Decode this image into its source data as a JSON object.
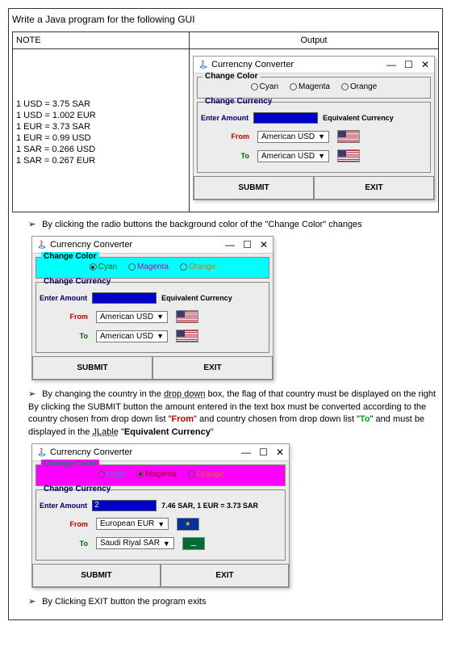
{
  "heading": "Write a Java program for the following GUI",
  "table": {
    "col1": "NOTE",
    "col2": "Output",
    "notes": [
      "1 USD = 3.75 SAR",
      "1 USD = 1.002 EUR",
      "1 EUR = 3.73 SAR",
      "1 EUR = 0.99 USD",
      "1 SAR = 0.266 USD",
      "1 SAR = 0.267 EUR"
    ]
  },
  "win_title": "Currencny Converter",
  "change_color_legend": "Change Color",
  "change_curr_legend": "Change Currency",
  "radios": {
    "cyan": "Cyan",
    "magenta": "Magenta",
    "orange": "Orange"
  },
  "labels": {
    "enter_amount": "Enter Amount",
    "equivalent": "Equivalent Currency",
    "from": "From",
    "to": "To",
    "submit": "SUBMIT",
    "exit": "EXIT"
  },
  "dropdowns": {
    "us": "American USD",
    "eu": "European EUR",
    "sa": "Saudi Riyal SAR"
  },
  "win3": {
    "amount_value": "2",
    "result": "7.46 SAR, 1 EUR = 3.73 SAR"
  },
  "bullets": {
    "b1": "By clicking the radio buttons the background color of the \"Change Color\" changes",
    "b2a": "By changing the country in the ",
    "b2_drop": "drop down",
    "b2b": " box, the flag of that country must be displayed on the right",
    "b2c": "By clicking the SUBMIT button the amount entered in the text box must be converted according to the country chosen from drop down list \"",
    "b2_from": "From",
    "b2d": "\" and country chosen from drop down list \"",
    "b2_to": "To",
    "b2e": "\" and must be displayed in the ",
    "b2_jl": "JLable",
    "b2f": " \"",
    "b2_eq": "Equivalent Currency",
    "b2g": "\"",
    "b3": "By Clicking EXIT button the program exits"
  }
}
